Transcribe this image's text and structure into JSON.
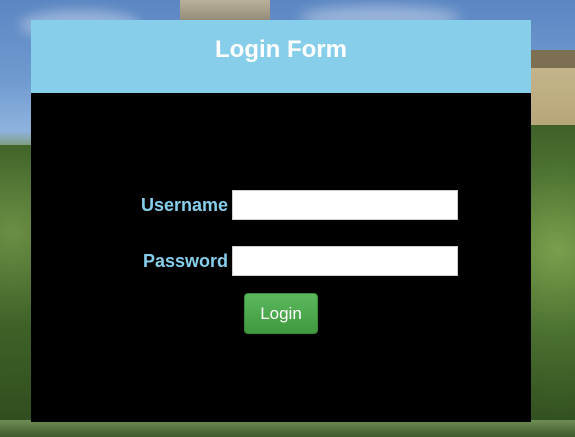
{
  "form": {
    "title": "Login Form",
    "username_label": "Username",
    "username_value": "",
    "password_label": "Password",
    "password_value": "",
    "login_button_label": "Login"
  },
  "colors": {
    "header_background": "#87ceeb",
    "panel_background": "#000000",
    "label_color": "#87ceeb",
    "button_color": "#4cae4c"
  }
}
